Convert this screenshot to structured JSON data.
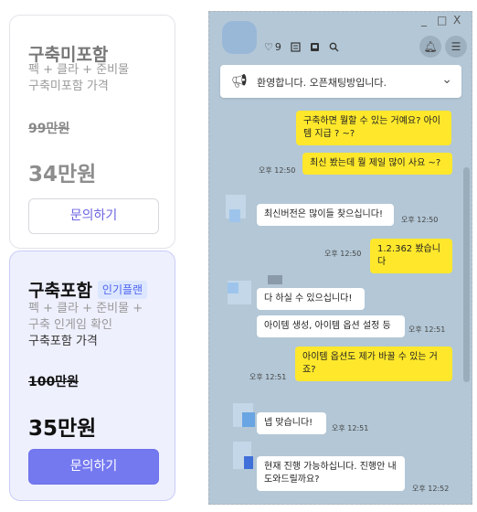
{
  "plans": {
    "basic": {
      "title": "구축미포함",
      "desc_line1": "펙 + 클라 + 준비물",
      "desc_line2": "구축미포함 가격",
      "old_price": "99만원",
      "price": "34만원",
      "button": "문의하기"
    },
    "plus": {
      "title": "구축포함",
      "badge": "인기플랜",
      "desc_line1": "펙 + 클라 + 준비물 +",
      "desc_line2": "구축 인게임 확인",
      "desc_line3": "구축포함 가격",
      "old_price": "100만원",
      "price": "35만원",
      "button": "문의하기"
    }
  },
  "chat": {
    "window_controls": {
      "minimize": "_",
      "maximize": "□",
      "close": "X"
    },
    "toolbar": {
      "heart_count": "9"
    },
    "notice": "환영합니다.      오픈채팅방입니다.",
    "messages": [
      {
        "from": "me",
        "text": "구축하면 뭘할 수 있는 거예요? 아이템 지급 ? ~?",
        "time": ""
      },
      {
        "from": "me",
        "text": "최신 봤는데 뭘 제일 많이 사요 ~?",
        "time": "오후 12:50"
      },
      {
        "from": "other",
        "text": "최신버전은 많이들 찾으십니다!",
        "time": "오후 12:50"
      },
      {
        "from": "me",
        "text": "1.2.362 봤습니다",
        "time": "오후 12:50"
      },
      {
        "from": "other",
        "text": "다 하실 수 있으십니다!",
        "time": ""
      },
      {
        "from": "other",
        "text": "아이템 생성, 아이템 옵션 설정 등",
        "time": "오후 12:51"
      },
      {
        "from": "me",
        "text": "아이템 옵션도 제가 바꿀 수 있는 거죠?",
        "time": "오후 12:51"
      },
      {
        "from": "other",
        "text": "넵 맞습니다!",
        "time": "오후 12:51"
      },
      {
        "from": "other",
        "text": "현재 진행 가능하십니다. 진행안 내 도와드릴까요?",
        "time": "오후 12:52"
      }
    ]
  },
  "colors": {
    "accent": "#7479f0",
    "badge_bg": "#dce7ff",
    "chat_bg": "#b3c7d6",
    "my_bubble": "#ffe82b"
  }
}
